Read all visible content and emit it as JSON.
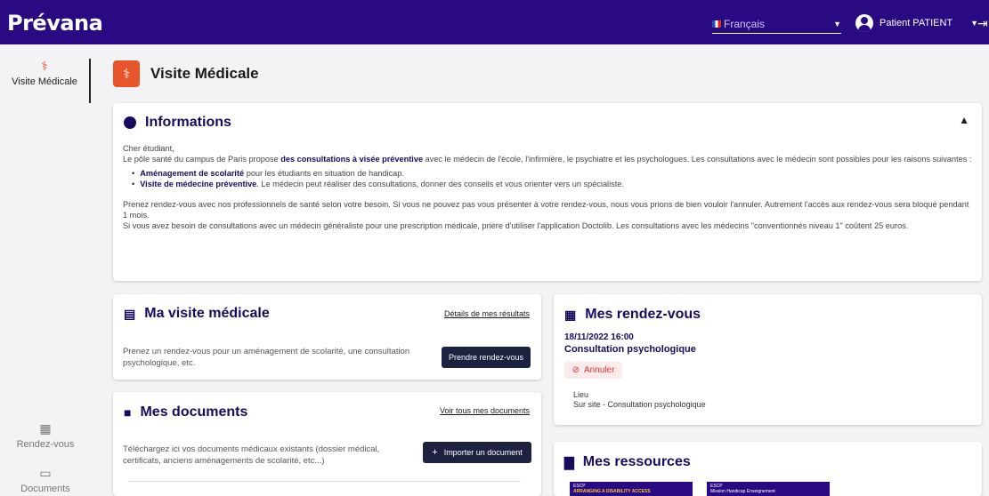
{
  "topbar": {
    "logo": "Prévana",
    "language": "Français",
    "user": "Patient PATIENT"
  },
  "sidebar": {
    "active": "Visite Médicale",
    "items": [
      "Rendez-vous",
      "Documents"
    ]
  },
  "page": {
    "title": "Visite Médicale"
  },
  "informations": {
    "title": "Informations",
    "greeting": "Cher étudiant,",
    "intro_a": "Le pôle santé du campus de Paris propose ",
    "intro_bold": "des consultations à visée préventive",
    "intro_b": " avec le médecin de l'école, l'infirmière, le psychiatre et les psychologues. Les consultations avec le médecin sont possibles pour les raisons suivantes :",
    "bullet1_bold": "Aménagement de scolarité",
    "bullet1_text": " pour les étudiants en situation de handicap.",
    "bullet2_bold": "Visite de médecine préventive",
    "bullet2_text": ". Le médecin peut réaliser des consultations, donner des conseils et vous orienter vers un spécialiste.",
    "para2": "Prenez rendez-vous avec nos professionnels de santé selon votre besoin. Si vous ne pouvez pas vous présenter à votre rendez-vous, nous vous prions de bien vouloir l'annuler. Autrement l'accès aux rendez-vous sera bloqué pendant 1 mois.",
    "para3": "Si vous avez besoin de consultations avec un médecin généraliste pour une prescription médicale, prière d'utiliser l'application Doctolib. Les consultations avec les médecins \"conventionnés niveau 1\" coûtent 25 euros."
  },
  "visite": {
    "title": "Ma visite médicale",
    "link": "Détails de mes résultats",
    "text": "Prenez un rendez-vous pour un aménagement de scolarité, une consultation psychologique, etc.",
    "button": "Prendre rendez-vous"
  },
  "documents": {
    "title": "Mes documents",
    "link": "Voir tous mes documents",
    "text": "Téléchargez ici vos documents médicaux existants (dossier médical, certificats, anciens aménagements de scolarité, etc...)",
    "button": "Importer un document"
  },
  "rdv": {
    "title": "Mes rendez-vous",
    "date": "18/11/2022 16:00",
    "type": "Consultation psychologique",
    "cancel": "Annuler",
    "lieu_label": "Lieu",
    "lieu_value": "Sur site - Consultation psychologique"
  },
  "ressources": {
    "title": "Mes ressources",
    "thumb1_brand": "ESCP",
    "thumb1_title": "ARRANGING A DISABILITY ACCESS",
    "thumb2_brand": "ESCP",
    "thumb2_title": "Mission Handicap Enseignement"
  },
  "colors": {
    "topbar": "#2a0a82",
    "accent": "#e8552a",
    "primary_text": "#1a0a5e",
    "button": "#1c2140"
  },
  "icons": [
    "stethoscope-icon",
    "chevron-down-icon",
    "user-avatar-icon",
    "logout-icon",
    "info-icon",
    "chevron-up-icon",
    "clipboard-icon",
    "folder-icon",
    "calendar-icon",
    "document-icon",
    "plus-icon",
    "cancel-icon"
  ]
}
